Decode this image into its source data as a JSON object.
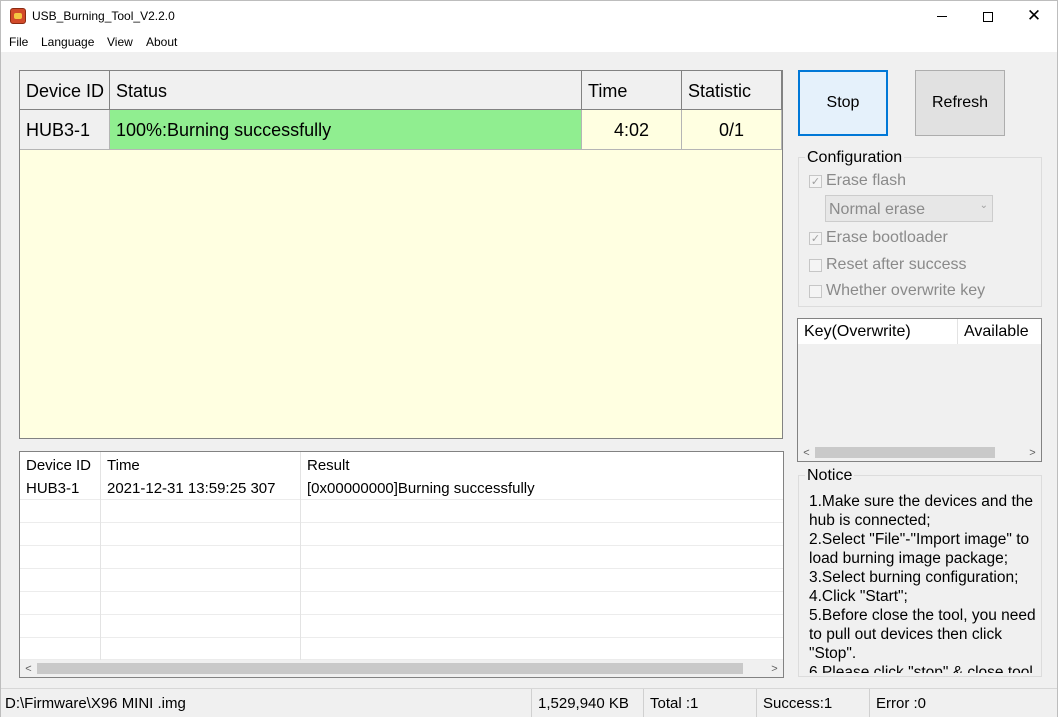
{
  "window": {
    "title": "USB_Burning_Tool_V2.2.0",
    "controls": {
      "minimize": "—",
      "maximize": "☐",
      "close": "✕"
    }
  },
  "menu": [
    "File",
    "Language",
    "View",
    "About"
  ],
  "device_grid": {
    "columns": [
      "Device ID",
      "Status",
      "Time",
      "Statistic"
    ],
    "rows": [
      {
        "device_id": "HUB3-1",
        "status": "100%:Burning successfully",
        "time": "4:02",
        "statistic": "0/1",
        "status_color": "#90ee90"
      }
    ],
    "background_color": "#ffffe1"
  },
  "log": {
    "columns": [
      "Device ID",
      "Time",
      "Result"
    ],
    "rows": [
      {
        "device_id": "HUB3-1",
        "time": "2021-12-31 13:59:25 307",
        "result": "[0x00000000]Burning successfully"
      }
    ]
  },
  "buttons": {
    "stop": "Stop",
    "refresh": "Refresh"
  },
  "configuration": {
    "title": "Configuration",
    "erase_flash": {
      "label": "Erase flash",
      "checked": true
    },
    "erase_mode": "Normal erase",
    "erase_bootloader": {
      "label": "Erase bootloader",
      "checked": true
    },
    "reset_after_success": {
      "label": "Reset after success",
      "checked": false
    },
    "overwrite_key": {
      "label": "Whether overwrite key",
      "checked": false
    }
  },
  "key_list": {
    "columns": [
      "Key(Overwrite)",
      "Available"
    ]
  },
  "notice": {
    "title": "Notice",
    "text": "1.Make sure the devices and the hub is connected;\n2.Select \"File\"-\"Import image\" to load burning image package;\n3.Select burning configuration;\n4.Click \"Start\";\n5.Before close the tool, you need to pull out devices then click \"Stop\".\n6.Please click \"stop\" & close tool"
  },
  "status_bar": {
    "image_path": "D:\\Firmware\\X96 MINI .img",
    "size": "1,529,940 KB",
    "total": "Total :1",
    "success": "Success:1",
    "error": "Error :0"
  }
}
